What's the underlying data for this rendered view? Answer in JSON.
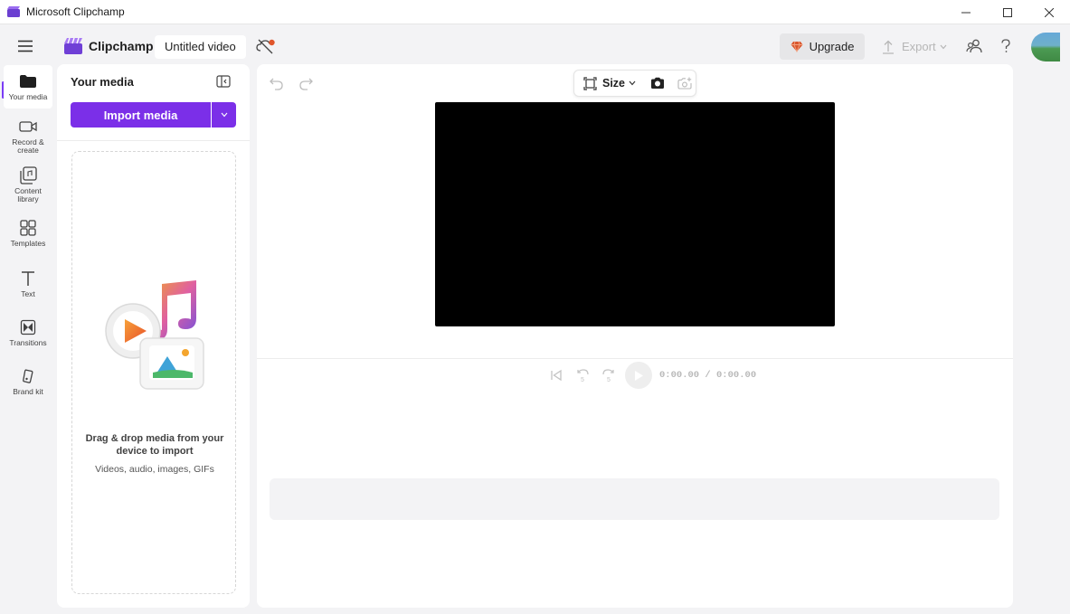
{
  "window": {
    "title": "Microsoft Clipchamp",
    "controls": [
      "minimize-icon",
      "maximize-icon",
      "close-icon"
    ]
  },
  "header": {
    "brand": "Clipchamp",
    "video_title": "Untitled video",
    "upgrade_label": "Upgrade",
    "export_label": "Export"
  },
  "rail": {
    "items": [
      {
        "label": "Your media",
        "icon": "folder-icon",
        "active": true
      },
      {
        "label": "Record & create",
        "icon": "camera-icon"
      },
      {
        "label": "Content library",
        "icon": "library-icon"
      },
      {
        "label": "Templates",
        "icon": "templates-icon"
      },
      {
        "label": "Text",
        "icon": "text-icon"
      },
      {
        "label": "Transitions",
        "icon": "transitions-icon"
      },
      {
        "label": "Brand kit",
        "icon": "brand-kit-icon"
      }
    ]
  },
  "media_panel": {
    "title": "Your media",
    "import_label": "Import media",
    "drop_text": "Drag & drop media from your device to import",
    "drop_subtext": "Videos, audio, images, GIFs"
  },
  "editor": {
    "size_label": "Size",
    "timecode": "0:00.00 / 0:00.00"
  },
  "colors": {
    "accent": "#7b2fe8",
    "preview_bg": "#000000",
    "app_bg": "#f3f3f5"
  }
}
